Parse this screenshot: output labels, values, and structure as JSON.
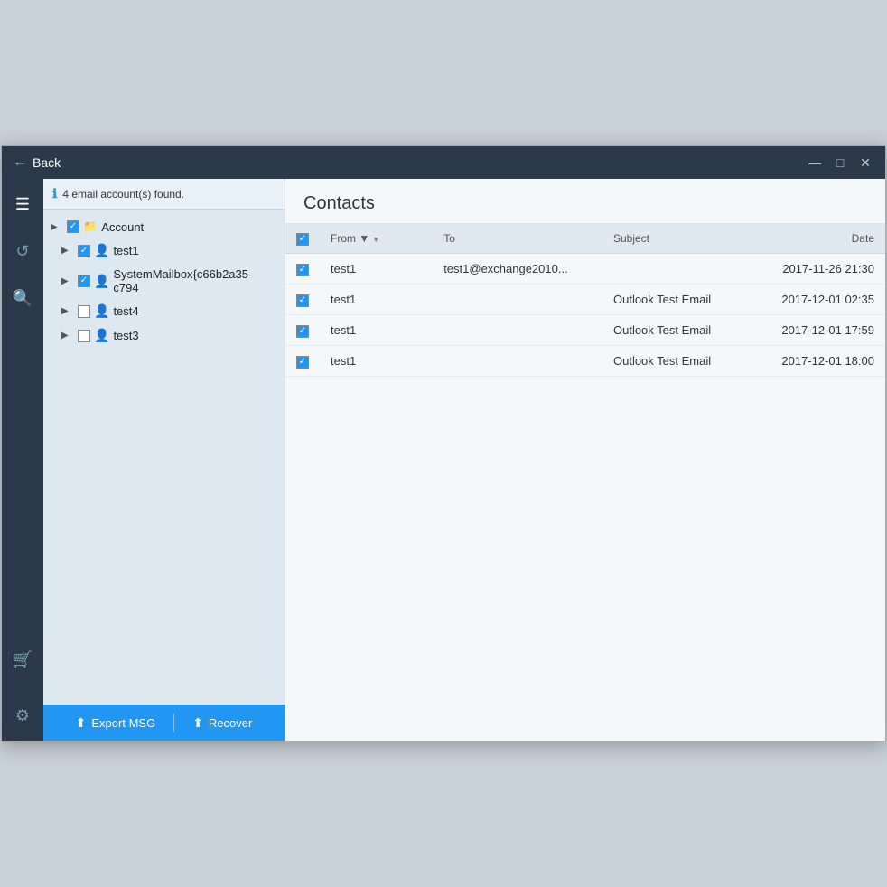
{
  "window": {
    "title": "Back",
    "controls": {
      "minimize": "—",
      "maximize": "□",
      "close": "✕"
    }
  },
  "info_bar": {
    "text": "4 email account(s) found."
  },
  "tree": {
    "root": {
      "label": "Account",
      "expanded": true,
      "checked": "partial"
    },
    "items": [
      {
        "label": "test1",
        "indent": 1,
        "checked": true,
        "expanded": true
      },
      {
        "label": "SystemMailbox{c66b2a35-c794",
        "indent": 1,
        "checked": true,
        "expanded": false
      },
      {
        "label": "test4",
        "indent": 1,
        "checked": false,
        "expanded": false
      },
      {
        "label": "test3",
        "indent": 1,
        "checked": false,
        "expanded": false
      }
    ]
  },
  "bottom_bar": {
    "export_label": "Export MSG",
    "recover_label": "Recover"
  },
  "right_panel": {
    "title": "Contacts",
    "table": {
      "columns": [
        "From",
        "To",
        "Subject",
        "Date"
      ],
      "rows": [
        {
          "checked": true,
          "from": "test1",
          "to": "test1@exchange2010...",
          "subject": "",
          "date": "2017-11-26 21:30"
        },
        {
          "checked": true,
          "from": "test1",
          "to": "",
          "subject": "Outlook Test Email",
          "date": "2017-12-01 02:35"
        },
        {
          "checked": true,
          "from": "test1",
          "to": "",
          "subject": "Outlook Test Email",
          "date": "2017-12-01 17:59"
        },
        {
          "checked": true,
          "from": "test1",
          "to": "",
          "subject": "Outlook Test Email",
          "date": "2017-12-01 18:00"
        }
      ]
    }
  },
  "sidebar": {
    "icons": [
      {
        "name": "list-icon",
        "symbol": "☰",
        "active": true
      },
      {
        "name": "refresh-icon",
        "symbol": "↺",
        "active": false
      },
      {
        "name": "search-icon",
        "symbol": "🔍",
        "active": false
      }
    ],
    "bottom_icons": [
      {
        "name": "cart-icon",
        "symbol": "🛒",
        "active": false
      },
      {
        "name": "settings-icon",
        "symbol": "⚙",
        "active": false
      }
    ]
  }
}
